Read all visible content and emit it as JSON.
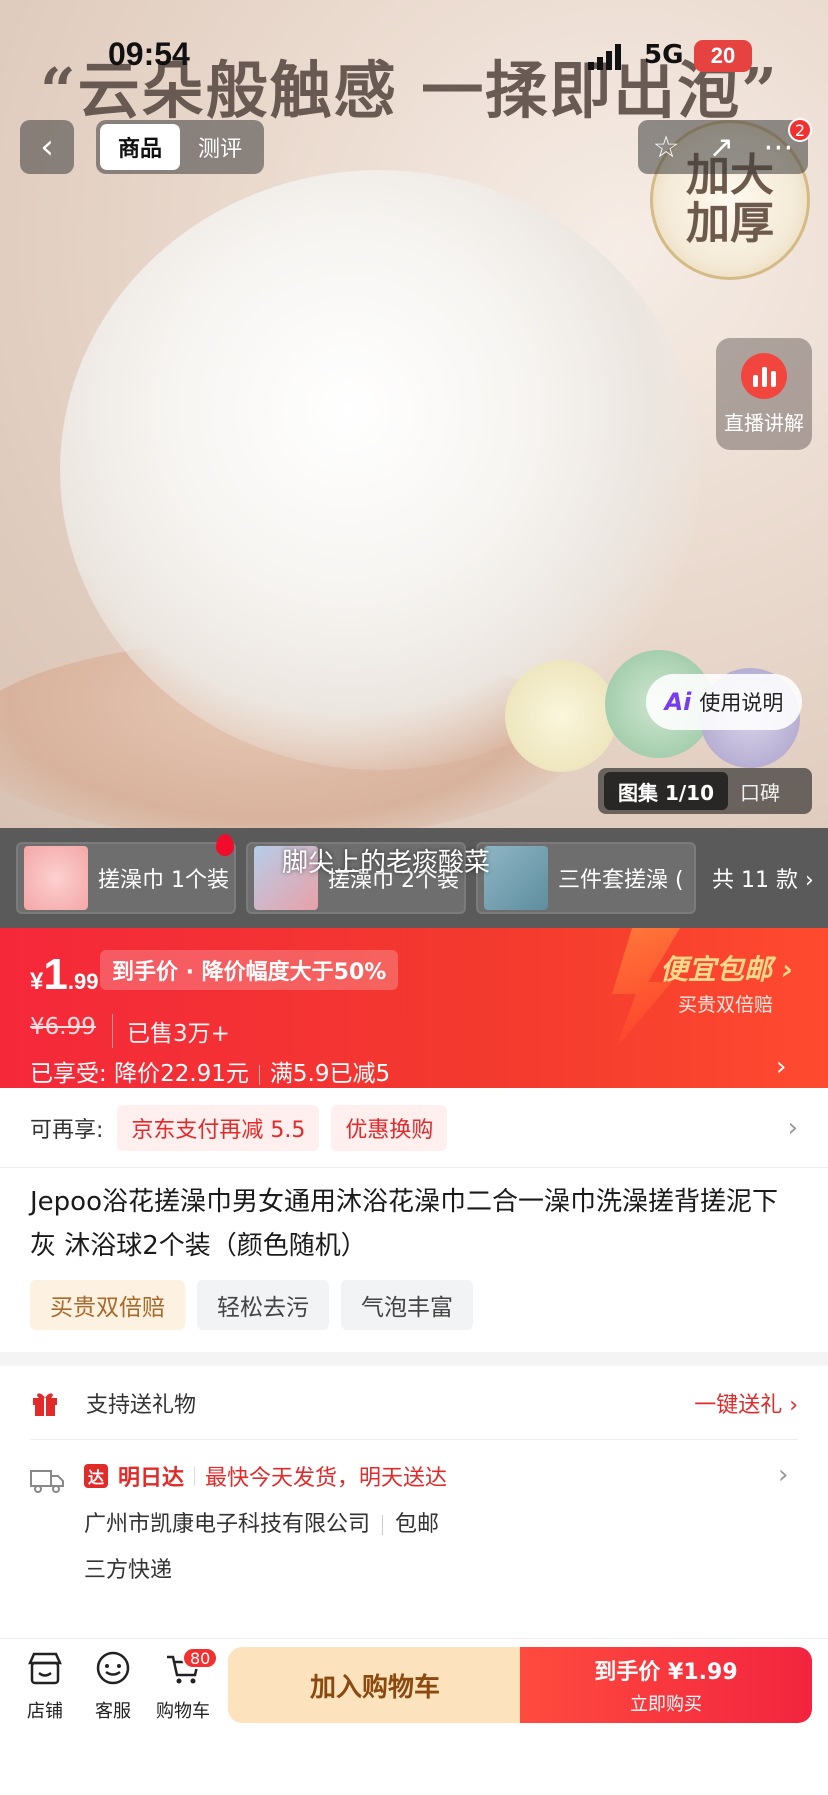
{
  "status_bar": {
    "time": "09:54",
    "network": "5G",
    "battery": "20"
  },
  "hero": {
    "slogan": "“云朵般触感 一揉即出泡”",
    "badge_line1": "加大",
    "badge_line2": "加厚"
  },
  "nav": {
    "tabs": [
      {
        "label": "商品",
        "active": true
      },
      {
        "label": "测评",
        "active": false
      }
    ],
    "notification_count": "2"
  },
  "live_button": {
    "label": "直播讲解"
  },
  "guide_button": {
    "icon_text": "Ai",
    "label": "使用说明"
  },
  "gallery": {
    "counter": "图集 1/10",
    "reviews_label": "口碑"
  },
  "variants": {
    "items": [
      {
        "label": "搓澡巾 1个装",
        "thumb_color": "#f4a6a6"
      },
      {
        "label": "搓澡巾 2个装",
        "thumb_color": "#c9d6ea"
      },
      {
        "label": "三件套搓澡 (",
        "thumb_color": "#8fb5c4"
      }
    ],
    "count_label": "共 11 款"
  },
  "floating_user": "脚尖上的老痰酸菜",
  "price": {
    "currency": "¥",
    "integer": "1",
    "decimal": ".99",
    "tag": "到手价 · 降价幅度大于50%",
    "original": "¥6.99",
    "sold": "已售3万+",
    "enjoy_label": "已享受:",
    "enjoy_discount": "降价22.91元",
    "enjoy_coupon": "满5.9已减5",
    "free_shipping": "便宜包邮",
    "free_shipping_sub": "买贵双倍赔"
  },
  "promo": {
    "label": "可再享:",
    "chips": [
      "京东支付再减 5.5",
      "优惠换购"
    ]
  },
  "product": {
    "title": "Jepoo浴花搓澡巾男女通用沐浴花澡巾二合一澡巾洗澡搓背搓泥下灰 沐浴球2个装（颜色随机）",
    "features": [
      {
        "label": "买贵双倍赔",
        "gold": true
      },
      {
        "label": "轻松去污",
        "gold": false
      },
      {
        "label": "气泡丰富",
        "gold": false
      }
    ]
  },
  "gift": {
    "label": "支持送礼物",
    "action": "一键送礼"
  },
  "shipping": {
    "logo_text": "达",
    "speed": "明日达",
    "note": "最快今天发货，明天送达",
    "seller": "广州市凯康电子科技有限公司",
    "free": "包邮",
    "carrier": "三方快递"
  },
  "bottom_bar": {
    "store": "店铺",
    "service": "客服",
    "cart": "购物车",
    "cart_count": "80",
    "add_to_cart": "加入购物车",
    "buy_line1": "到手价 ¥1.99",
    "buy_line2": "立即购买"
  },
  "colors": {
    "accent_red": "#f5283a",
    "gold": "#ffd98a"
  }
}
